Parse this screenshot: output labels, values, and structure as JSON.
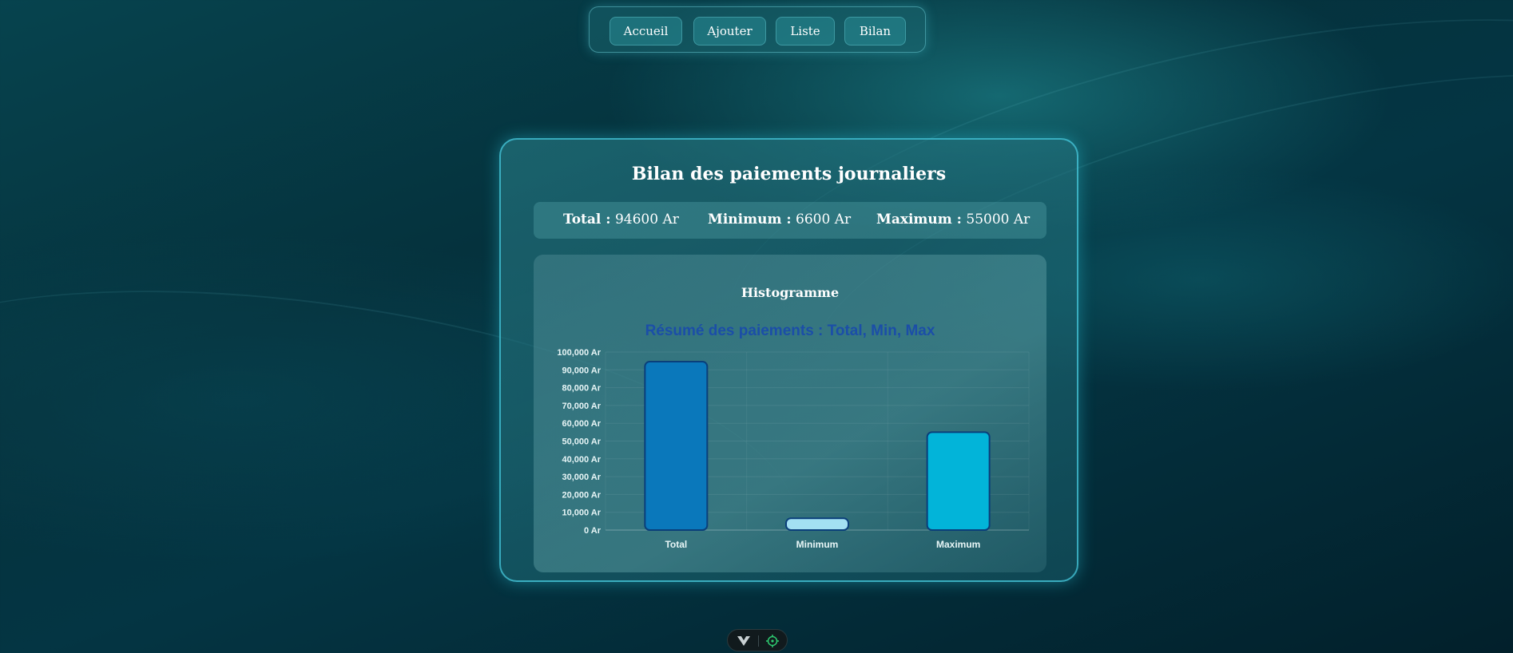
{
  "nav": {
    "items": [
      {
        "label": "Accueil"
      },
      {
        "label": "Ajouter"
      },
      {
        "label": "Liste"
      },
      {
        "label": "Bilan"
      }
    ]
  },
  "card": {
    "title": "Bilan des paiements journaliers",
    "stats": {
      "total_label": "Total :",
      "total_value": "94600 Ar",
      "min_label": "Minimum :",
      "min_value": "6600 Ar",
      "max_label": "Maximum :",
      "max_value": "55000 Ar"
    },
    "chart_heading": "Histogramme"
  },
  "chart_data": {
    "type": "bar",
    "title": "Résumé des paiements : Total, Min, Max",
    "categories": [
      "Total",
      "Minimum",
      "Maximum"
    ],
    "values": [
      94600,
      6600,
      55000
    ],
    "colors": [
      "#0a78bb",
      "#a3e0f2",
      "#02b4d9"
    ],
    "border_color": "#0a3f7a",
    "title_color": "#1b4ea8",
    "ylim": [
      0,
      100000
    ],
    "ytick_step": 10000,
    "ytick_labels": [
      "0 Ar",
      "10,000 Ar",
      "20,000 Ar",
      "30,000 Ar",
      "40,000 Ar",
      "50,000 Ar",
      "60,000 Ar",
      "70,000 Ar",
      "80,000 Ar",
      "90,000 Ar",
      "100,000 Ar"
    ],
    "grid": true
  },
  "devbar": {
    "icons": [
      "vue-devtools-icon",
      "target-icon"
    ]
  }
}
